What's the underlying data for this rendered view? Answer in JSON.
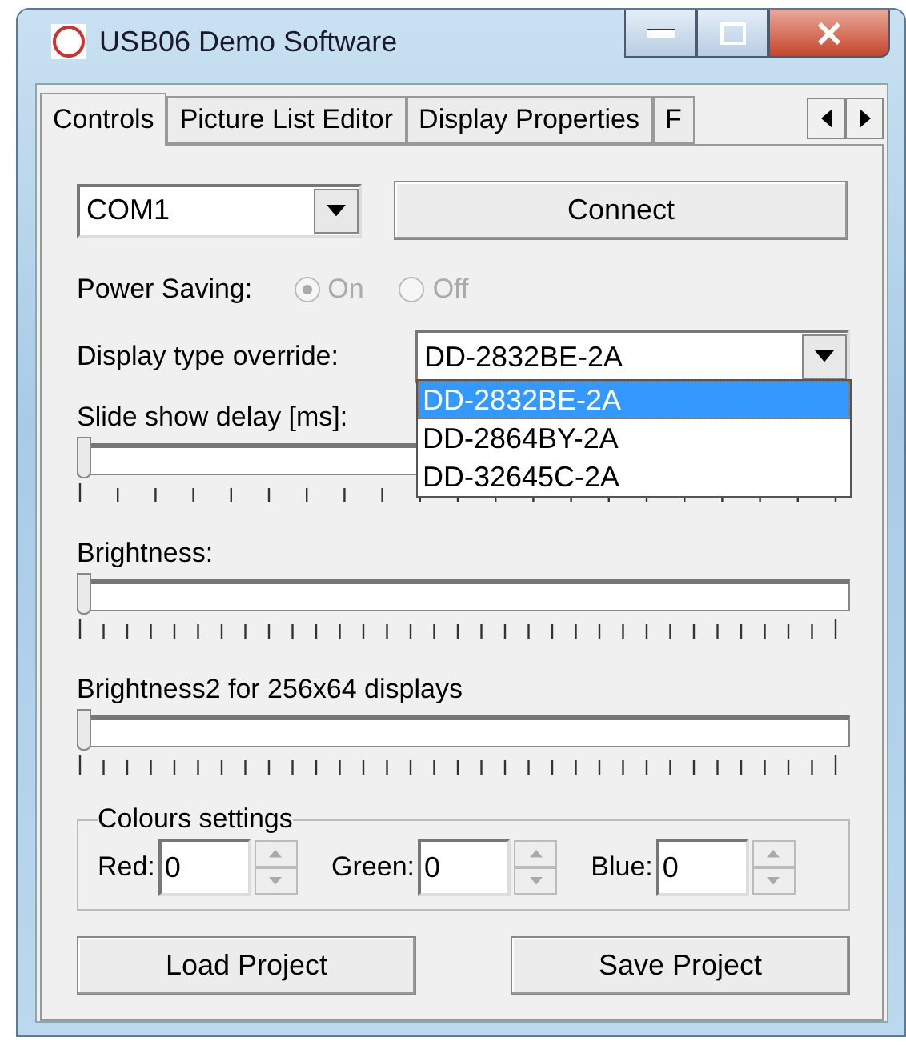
{
  "window": {
    "title": "USB06 Demo Software"
  },
  "tabs": [
    {
      "label": "Controls",
      "selected": true
    },
    {
      "label": "Picture List Editor",
      "selected": false
    },
    {
      "label": "Display Properties",
      "selected": false
    },
    {
      "label": "F",
      "selected": false
    }
  ],
  "port": {
    "value": "COM1"
  },
  "connect_button": "Connect",
  "power_saving": {
    "label": "Power Saving:",
    "options": [
      {
        "label": "On",
        "selected": true,
        "disabled": true
      },
      {
        "label": "Off",
        "selected": false,
        "disabled": true
      }
    ]
  },
  "display_type": {
    "label": "Display type override:",
    "value": "DD-2832BE-2A",
    "expanded": true,
    "options": [
      {
        "label": "DD-2832BE-2A",
        "selected": true
      },
      {
        "label": "DD-2864BY-2A",
        "selected": false
      },
      {
        "label": "DD-32645C-2A",
        "selected": false
      }
    ]
  },
  "sliders": [
    {
      "label": "Slide show delay [ms]:",
      "level": 0
    },
    {
      "label": "Brightness:",
      "level": 0
    },
    {
      "label": "Brightness2 for 256x64 displays",
      "level": 0
    }
  ],
  "colours": {
    "title": "Colours settings",
    "fields": [
      {
        "label": "Red:",
        "value": "0"
      },
      {
        "label": "Green:",
        "value": "0"
      },
      {
        "label": "Blue:",
        "value": "0"
      }
    ]
  },
  "buttons": [
    "Load Project",
    "Save Project"
  ]
}
